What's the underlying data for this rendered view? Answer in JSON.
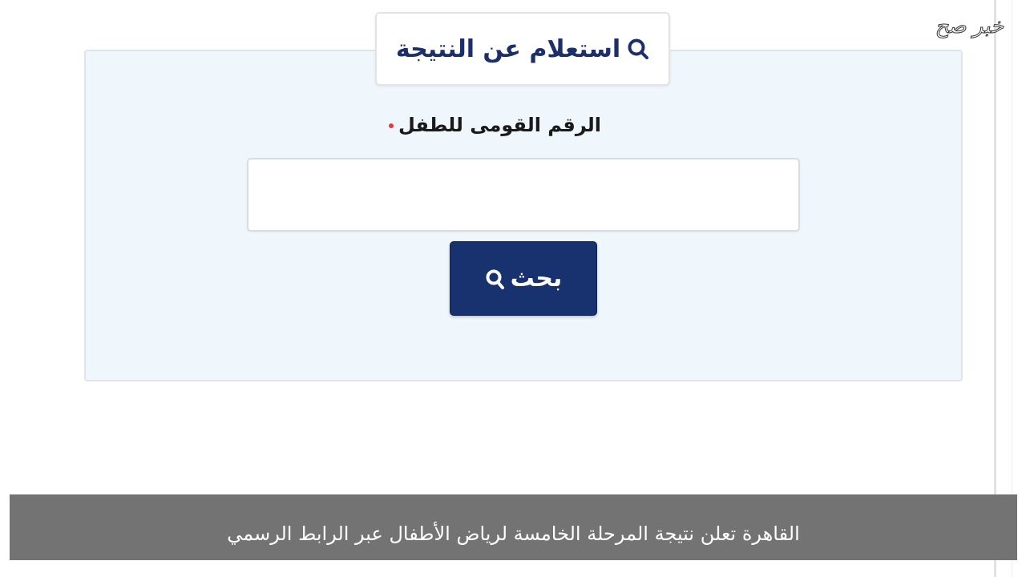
{
  "watermark": {
    "text": "خبر صح"
  },
  "form": {
    "title": "استعلام عن النتيجة",
    "title_icon": "search-icon",
    "field_label": "الرقم القومى للطفل",
    "field_required": true,
    "field_value": "",
    "button_label": "بحث",
    "button_icon": "search-icon"
  },
  "caption": {
    "text": "القاهرة تعلن نتيجة المرحلة الخامسة لرياض الأطفال عبر الرابط الرسمي"
  },
  "colors": {
    "brand_navy": "#18326f",
    "panel_background": "#eff7fd",
    "required_marker": "#e23b3b",
    "caption_background": "#737373"
  }
}
